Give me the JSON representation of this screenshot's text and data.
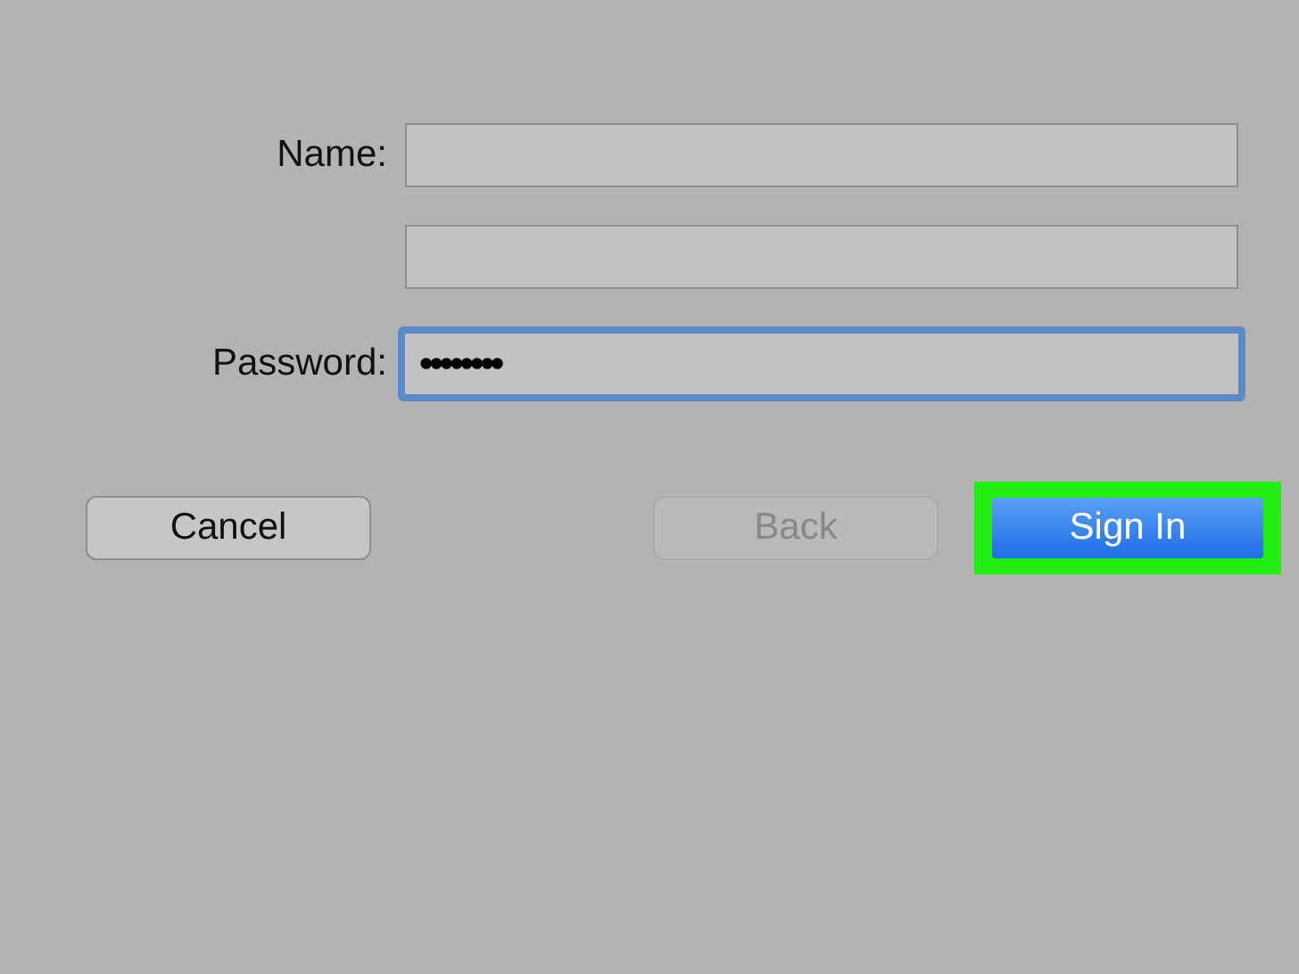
{
  "fields": [
    {
      "label": "Name:",
      "focused": false
    },
    {
      "focused": false
    },
    {
      "label": "Password:",
      "value": "••••••••",
      "focused": true
    }
  ],
  "buttons": [
    {
      "label": "Cancel",
      "kind": "normal",
      "disabled": false,
      "highlighted": false
    },
    {
      "label": "Back",
      "kind": "normal",
      "disabled": true,
      "highlighted": false
    },
    {
      "label": "Sign In",
      "kind": "default",
      "disabled": false,
      "highlighted": true
    }
  ]
}
